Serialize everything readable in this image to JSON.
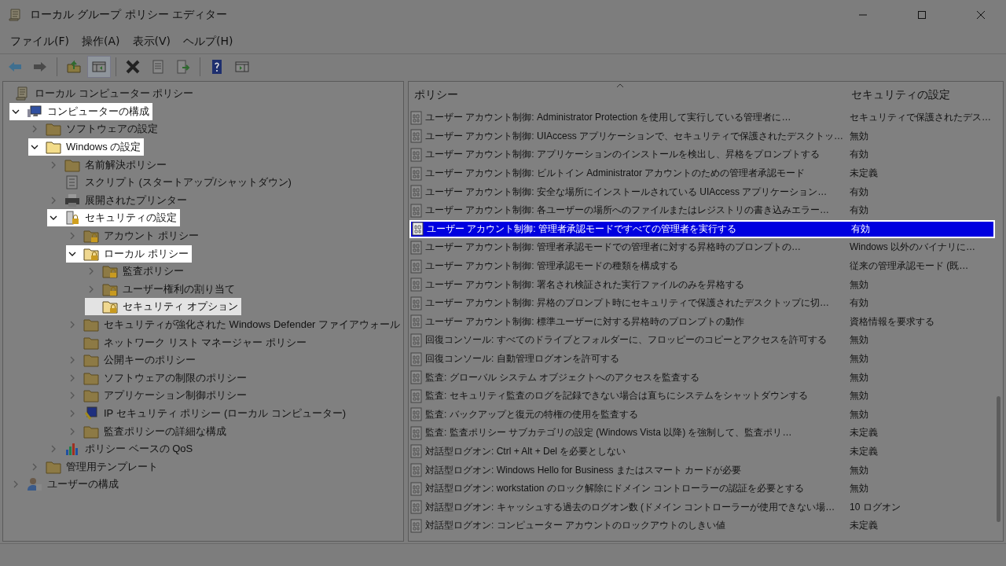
{
  "window": {
    "title": "ローカル グループ ポリシー エディター"
  },
  "menu": [
    "ファイル(F)",
    "操作(A)",
    "表示(V)",
    "ヘルプ(H)"
  ],
  "toolbar": [
    [
      {
        "kind": "back",
        "pressed": false
      },
      {
        "kind": "forward",
        "pressed": false
      }
    ],
    [
      {
        "kind": "up",
        "pressed": false
      },
      {
        "kind": "tree",
        "pressed": true
      }
    ],
    [
      {
        "kind": "delete",
        "pressed": false
      },
      {
        "kind": "properties",
        "pressed": false
      },
      {
        "kind": "export",
        "pressed": false
      }
    ],
    [
      {
        "kind": "help",
        "pressed": false
      },
      {
        "kind": "actionpane",
        "pressed": false
      }
    ]
  ],
  "tree": [
    {
      "label": "ローカル コンピューター ポリシー",
      "kind": "scroll",
      "highlighted": false,
      "selected": false,
      "children": [
        {
          "label": "コンピューターの構成",
          "kind": "computer",
          "expanded": true,
          "highlighted": true,
          "selected": false,
          "children": [
            {
              "label": "ソフトウェアの設定",
              "kind": "folder",
              "expanded": false,
              "highlighted": false,
              "selected": false
            },
            {
              "label": "Windows の設定",
              "kind": "folder",
              "expanded": true,
              "highlighted": true,
              "selected": false,
              "children": [
                {
                  "label": "名前解決ポリシー",
                  "kind": "folder",
                  "expanded": false,
                  "highlighted": false,
                  "selected": false
                },
                {
                  "label": "スクリプト (スタートアップ/シャットダウン)",
                  "kind": "script",
                  "highlighted": false,
                  "selected": false
                },
                {
                  "label": "展開されたプリンター",
                  "kind": "printer",
                  "expanded": false,
                  "highlighted": false,
                  "selected": false
                },
                {
                  "label": "セキュリティの設定",
                  "kind": "security",
                  "expanded": true,
                  "highlighted": true,
                  "selected": false,
                  "children": [
                    {
                      "label": "アカウント ポリシー",
                      "kind": "lockfolder",
                      "expanded": false,
                      "highlighted": false,
                      "selected": false
                    },
                    {
                      "label": "ローカル ポリシー",
                      "kind": "lockfolder",
                      "expanded": true,
                      "highlighted": true,
                      "selected": false,
                      "children": [
                        {
                          "label": "監査ポリシー",
                          "kind": "lockfolder",
                          "expanded": false,
                          "highlighted": false,
                          "selected": false
                        },
                        {
                          "label": "ユーザー権利の割り当て",
                          "kind": "lockfolder",
                          "expanded": false,
                          "highlighted": false,
                          "selected": false
                        },
                        {
                          "label": "セキュリティ オプション",
                          "kind": "lockfolder",
                          "highlighted": false,
                          "selected": true
                        }
                      ]
                    },
                    {
                      "label": "セキュリティが強化された Windows Defender ファイアウォール",
                      "kind": "folder",
                      "expanded": false,
                      "highlighted": false,
                      "selected": false
                    },
                    {
                      "label": "ネットワーク リスト マネージャー ポリシー",
                      "kind": "folder",
                      "highlighted": false,
                      "selected": false
                    },
                    {
                      "label": "公開キーのポリシー",
                      "kind": "folder",
                      "expanded": false,
                      "highlighted": false,
                      "selected": false
                    },
                    {
                      "label": "ソフトウェアの制限のポリシー",
                      "kind": "folder",
                      "expanded": false,
                      "highlighted": false,
                      "selected": false
                    },
                    {
                      "label": "アプリケーション制御ポリシー",
                      "kind": "folder",
                      "expanded": false,
                      "highlighted": false,
                      "selected": false
                    },
                    {
                      "label": "IP セキュリティ ポリシー (ローカル コンピューター)",
                      "kind": "ipsec",
                      "expanded": false,
                      "highlighted": false,
                      "selected": false
                    },
                    {
                      "label": "監査ポリシーの詳細な構成",
                      "kind": "folder",
                      "expanded": false,
                      "highlighted": false,
                      "selected": false
                    }
                  ]
                },
                {
                  "label": "ポリシー ベースの QoS",
                  "kind": "qos",
                  "expanded": false,
                  "highlighted": false,
                  "selected": false
                }
              ]
            },
            {
              "label": "管理用テンプレート",
              "kind": "folder",
              "expanded": false,
              "highlighted": false,
              "selected": false
            }
          ]
        },
        {
          "label": "ユーザーの構成",
          "kind": "user",
          "expanded": false,
          "highlighted": false,
          "selected": false
        }
      ]
    }
  ],
  "table": {
    "columns": [
      "ポリシー",
      "セキュリティの設定"
    ],
    "rows": [
      {
        "policy": "ユーザー アカウント制御: Administrator Protection を使用して実行している管理者に…",
        "setting": "セキュリティで保護されたデス…",
        "selected": false
      },
      {
        "policy": "ユーザー アカウント制御: UIAccess アプリケーションで、セキュリティで保護されたデスクトッ…",
        "setting": "無効",
        "selected": false
      },
      {
        "policy": "ユーザー アカウント制御: アプリケーションのインストールを検出し、昇格をプロンプトする",
        "setting": "有効",
        "selected": false
      },
      {
        "policy": "ユーザー アカウント制御: ビルトイン Administrator アカウントのための管理者承認モード",
        "setting": "未定義",
        "selected": false
      },
      {
        "policy": "ユーザー アカウント制御: 安全な場所にインストールされている UIAccess アプリケーション…",
        "setting": "有効",
        "selected": false
      },
      {
        "policy": "ユーザー アカウント制御: 各ユーザーの場所へのファイルまたはレジストリの書き込みエラー…",
        "setting": "有効",
        "selected": false
      },
      {
        "policy": "ユーザー アカウント制御: 管理者承認モードですべての管理者を実行する",
        "setting": "有効",
        "selected": true
      },
      {
        "policy": "ユーザー アカウント制御: 管理者承認モードでの管理者に対する昇格時のプロンプトの…",
        "setting": "Windows 以外のバイナリに…",
        "selected": false
      },
      {
        "policy": "ユーザー アカウント制御: 管理承認モードの種類を構成する",
        "setting": "従来の管理承認モード (既…",
        "selected": false
      },
      {
        "policy": "ユーザー アカウント制御: 署名され検証された実行ファイルのみを昇格する",
        "setting": "無効",
        "selected": false
      },
      {
        "policy": "ユーザー アカウント制御: 昇格のプロンプト時にセキュリティで保護されたデスクトップに切…",
        "setting": "有効",
        "selected": false
      },
      {
        "policy": "ユーザー アカウント制御: 標準ユーザーに対する昇格時のプロンプトの動作",
        "setting": "資格情報を要求する",
        "selected": false
      },
      {
        "policy": "回復コンソール: すべてのドライブとフォルダーに、フロッピーのコピーとアクセスを許可する",
        "setting": "無効",
        "selected": false
      },
      {
        "policy": "回復コンソール: 自動管理ログオンを許可する",
        "setting": "無効",
        "selected": false
      },
      {
        "policy": "監査: グローバル システム オブジェクトへのアクセスを監査する",
        "setting": "無効",
        "selected": false
      },
      {
        "policy": "監査: セキュリティ監査のログを記録できない場合は直ちにシステムをシャットダウンする",
        "setting": "無効",
        "selected": false
      },
      {
        "policy": "監査: バックアップと復元の特権の使用を監査する",
        "setting": "無効",
        "selected": false
      },
      {
        "policy": "監査: 監査ポリシー サブカテゴリの設定 (Windows Vista 以降) を強制して、監査ポリ…",
        "setting": "未定義",
        "selected": false
      },
      {
        "policy": "対話型ログオン: Ctrl + Alt + Del を必要としない",
        "setting": "未定義",
        "selected": false
      },
      {
        "policy": "対話型ログオン: Windows Hello for Business またはスマート カードが必要",
        "setting": "無効",
        "selected": false
      },
      {
        "policy": "対話型ログオン: workstation のロック解除にドメイン コントローラーの認証を必要とする",
        "setting": "無効",
        "selected": false
      },
      {
        "policy": "対話型ログオン: キャッシュする過去のログオン数 (ドメイン コントローラーが使用できない場…",
        "setting": "10 ログオン",
        "selected": false
      },
      {
        "policy": "対話型ログオン: コンピューター アカウントのロックアウトのしきい値",
        "setting": "未定義",
        "selected": false
      }
    ]
  }
}
